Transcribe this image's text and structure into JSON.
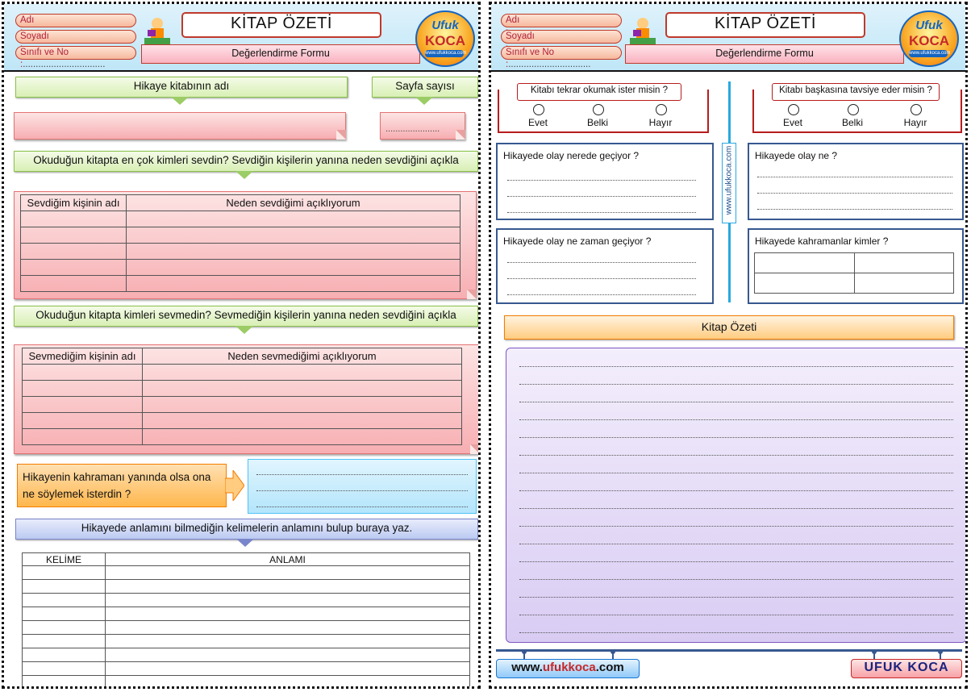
{
  "header": {
    "name_label": "Adı :",
    "name_dots": "..........................................",
    "surname_label": "Soyadı :",
    "surname_dots": ".....................................",
    "class_label": "Sınıfı ve No :",
    "class_dots": "................................",
    "title": "KİTAP ÖZETİ",
    "subtitle": "Değerlendirme Formu",
    "logo_line1": "Ufuk",
    "logo_line2": "KOCA",
    "logo_line3": "www.ufukkoca.com"
  },
  "left": {
    "book_name_label": "Hikaye kitabının adı",
    "page_count_label": "Sayfa sayısı",
    "page_count_dots": "......................",
    "liked_question": "Okuduğun kitapta en çok kimleri sevdin? Sevdiğin kişilerin yanına neden sevdiğini açıkla",
    "liked_table": {
      "col1": "Sevdiğim kişinin adı",
      "col2": "Neden sevdiğimi açıklıyorum"
    },
    "disliked_question": "Okuduğun kitapta kimleri sevmedin? Sevmediğin kişilerin yanına neden sevdiğini açıkla",
    "disliked_table": {
      "col1": "Sevmediğim kişinin adı",
      "col2": "Neden sevmediğimi açıklıyorum"
    },
    "hero_question_line1": "Hikayenin kahramanı yanında olsa ona",
    "hero_question_line2": "ne söylemek isterdin ?",
    "vocab_instruction": "Hikayede anlamını bilmediğin kelimelerin anlamını bulup buraya yaz.",
    "vocab_table": {
      "col1": "KELİME",
      "col2": "ANLAMI"
    }
  },
  "right": {
    "reread_question": "Kitabı tekrar okumak ister misin ?",
    "recommend_question": "Kitabı başkasına tavsiye eder misin ?",
    "options": [
      "Evet",
      "Belki",
      "Hayır"
    ],
    "where_question": "Hikayede olay nerede geçiyor ?",
    "what_question": "Hikayede olay ne ?",
    "when_question": "Hikayede olay ne zaman geçiyor ?",
    "characters_question": "Hikayede kahramanlar kimler ?",
    "vertical_url": "www.ufukkoca.com",
    "summary_title": "Kitap Özeti",
    "footer_url_prefix": "www.",
    "footer_url_highlight": "ufukkoca",
    "footer_url_suffix": ".com",
    "footer_name": "UFUK KOCA"
  }
}
